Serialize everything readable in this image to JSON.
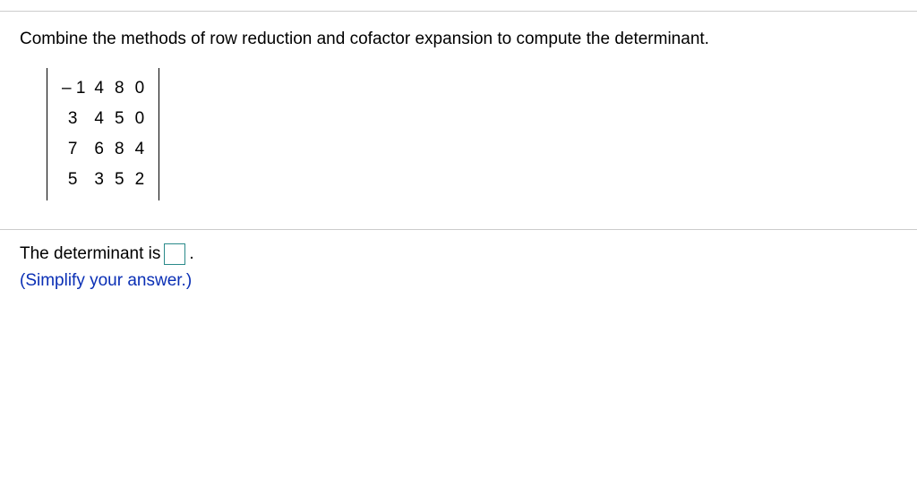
{
  "question": {
    "prompt": "Combine the methods of row reduction and cofactor expansion to compute the determinant.",
    "matrix": {
      "r0": {
        "c0": "– 1",
        "c1": "4",
        "c2": "8",
        "c3": "0"
      },
      "r1": {
        "c0": "3",
        "c1": "4",
        "c2": "5",
        "c3": "0"
      },
      "r2": {
        "c0": "7",
        "c1": "6",
        "c2": "8",
        "c3": "4"
      },
      "r3": {
        "c0": "5",
        "c1": "3",
        "c2": "5",
        "c3": "2"
      }
    }
  },
  "answer": {
    "prefix": "The determinant is ",
    "suffix": ".",
    "hint": "(Simplify your answer.)"
  }
}
